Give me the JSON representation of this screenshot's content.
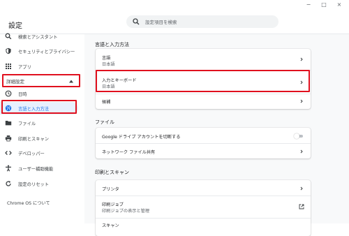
{
  "window": {
    "controls": [
      "−",
      "□",
      "×"
    ]
  },
  "header": {
    "title": "設定",
    "search_placeholder": "設定項目を検索"
  },
  "sidebar": {
    "items_top": [
      {
        "label": "検索とアシスタント",
        "icon": "search-icon"
      },
      {
        "label": "セキュリティとプライバシー",
        "icon": "shield-icon"
      },
      {
        "label": "アプリ",
        "icon": "apps-grid-icon"
      }
    ],
    "advanced_label": "詳細設定",
    "items_advanced": [
      {
        "label": "日時",
        "icon": "clock-icon"
      },
      {
        "label": "言語と入力方法",
        "icon": "globe-icon",
        "active": true
      },
      {
        "label": "ファイル",
        "icon": "folder-icon"
      },
      {
        "label": "印刷とスキャン",
        "icon": "printer-icon"
      },
      {
        "label": "デベロッパー",
        "icon": "code-icon"
      },
      {
        "label": "ユーザー補助機能",
        "icon": "accessibility-icon"
      },
      {
        "label": "設定のリセット",
        "icon": "reset-icon"
      }
    ],
    "about": "Chrome OS について"
  },
  "main": {
    "lang_section": {
      "title": "言語と入力方法",
      "rows": [
        {
          "title": "言語",
          "subtitle": "日本語"
        },
        {
          "title": "入力とキーボード",
          "subtitle": "日本語"
        },
        {
          "title": "候補"
        }
      ]
    },
    "files_section": {
      "title": "ファイル",
      "rows": [
        {
          "title": "Google ドライブ アカウントを切断する",
          "toggle_on": false
        },
        {
          "title": "ネットワーク ファイル共有"
        }
      ]
    },
    "print_section": {
      "title": "印刷とスキャン",
      "rows": [
        {
          "title": "プリンタ"
        },
        {
          "title": "印刷ジョブ",
          "subtitle": "印刷ジョブの表示と管理"
        },
        {
          "title": "スキャン"
        }
      ]
    }
  },
  "colors": {
    "accent": "#1a73e8",
    "highlight": "#e0101e",
    "active_bg": "#e8f0fe",
    "main_bg": "#f8f9fa"
  }
}
